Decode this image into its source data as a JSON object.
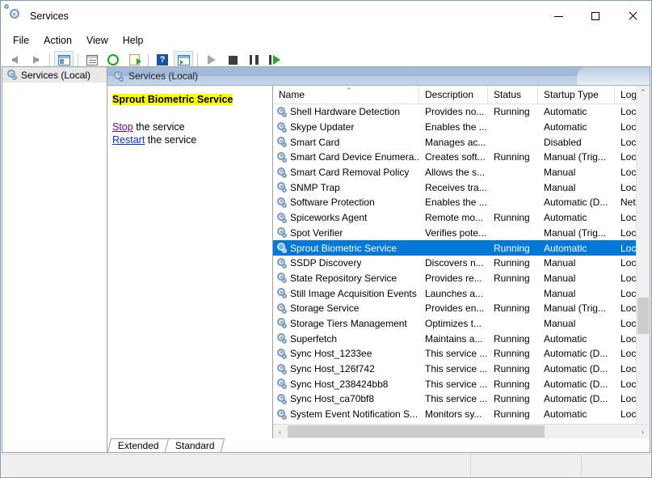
{
  "window": {
    "title": "Services",
    "icon": "services-gear-icon",
    "minimize": "minimize",
    "maximize": "maximize",
    "close": "close"
  },
  "menubar": {
    "items": [
      {
        "label": "File",
        "name": "menu-file"
      },
      {
        "label": "Action",
        "name": "menu-action"
      },
      {
        "label": "View",
        "name": "menu-view"
      },
      {
        "label": "Help",
        "name": "menu-help"
      }
    ]
  },
  "toolbar": {
    "buttons": [
      {
        "name": "back-button",
        "icon": "arrow-left-icon"
      },
      {
        "name": "forward-button",
        "icon": "arrow-right-icon"
      },
      {
        "name": "show-hide-console-tree-button",
        "icon": "console-tree-icon"
      },
      {
        "name": "properties-button",
        "icon": "properties-icon"
      },
      {
        "name": "refresh-button",
        "icon": "refresh-icon"
      },
      {
        "name": "export-list-button",
        "icon": "export-list-icon"
      },
      {
        "name": "help-button",
        "icon": "help-icon"
      },
      {
        "name": "show-action-pane-button",
        "icon": "action-pane-icon"
      },
      {
        "name": "start-service-button",
        "icon": "play-icon"
      },
      {
        "name": "stop-service-button",
        "icon": "stop-icon"
      },
      {
        "name": "pause-service-button",
        "icon": "pause-icon"
      },
      {
        "name": "restart-service-button",
        "icon": "restart-icon"
      }
    ]
  },
  "tree": {
    "root_label": "Services (Local)",
    "root_icon": "services-gear-icon"
  },
  "pane": {
    "header_label": "Services (Local)",
    "header_icon": "services-gear-icon"
  },
  "detail": {
    "service_name": "Sprout Biometric Service",
    "highlight_color": "#ffff00",
    "stop_link": "Stop",
    "stop_suffix": " the service",
    "restart_link": "Restart",
    "restart_suffix": " the service"
  },
  "list": {
    "sort_column": "Name",
    "sort_indicator": "⌃",
    "columns": [
      {
        "label": "Name",
        "name": "column-header-name"
      },
      {
        "label": "Description",
        "name": "column-header-description"
      },
      {
        "label": "Status",
        "name": "column-header-status"
      },
      {
        "label": "Startup Type",
        "name": "column-header-startup-type"
      },
      {
        "label": "Log",
        "name": "column-header-log-on-as"
      }
    ],
    "selected_index": 9,
    "rows": [
      {
        "name": "Shell Hardware Detection",
        "description": "Provides no...",
        "status": "Running",
        "startup": "Automatic",
        "logon": "Loc"
      },
      {
        "name": "Skype Updater",
        "description": "Enables the ...",
        "status": "",
        "startup": "Automatic",
        "logon": "Loc"
      },
      {
        "name": "Smart Card",
        "description": "Manages ac...",
        "status": "",
        "startup": "Disabled",
        "logon": "Loc"
      },
      {
        "name": "Smart Card Device Enumera...",
        "description": "Creates soft...",
        "status": "Running",
        "startup": "Manual (Trig...",
        "logon": "Loc"
      },
      {
        "name": "Smart Card Removal Policy",
        "description": "Allows the s...",
        "status": "",
        "startup": "Manual",
        "logon": "Loc"
      },
      {
        "name": "SNMP Trap",
        "description": "Receives tra...",
        "status": "",
        "startup": "Manual",
        "logon": "Loc"
      },
      {
        "name": "Software Protection",
        "description": "Enables the ...",
        "status": "",
        "startup": "Automatic (D...",
        "logon": "Net"
      },
      {
        "name": "Spiceworks Agent",
        "description": "Remote mo...",
        "status": "Running",
        "startup": "Automatic",
        "logon": "Loc"
      },
      {
        "name": "Spot Verifier",
        "description": "Verifies pote...",
        "status": "",
        "startup": "Manual (Trig...",
        "logon": "Loc"
      },
      {
        "name": "Sprout Biometric Service",
        "description": "",
        "status": "Running",
        "startup": "Automatic",
        "logon": "Loc"
      },
      {
        "name": "SSDP Discovery",
        "description": "Discovers n...",
        "status": "Running",
        "startup": "Manual",
        "logon": "Loc"
      },
      {
        "name": "State Repository Service",
        "description": "Provides re...",
        "status": "Running",
        "startup": "Manual",
        "logon": "Loc"
      },
      {
        "name": "Still Image Acquisition Events",
        "description": "Launches a...",
        "status": "",
        "startup": "Manual",
        "logon": "Loc"
      },
      {
        "name": "Storage Service",
        "description": "Provides en...",
        "status": "Running",
        "startup": "Manual (Trig...",
        "logon": "Loc"
      },
      {
        "name": "Storage Tiers Management",
        "description": "Optimizes t...",
        "status": "",
        "startup": "Manual",
        "logon": "Loc"
      },
      {
        "name": "Superfetch",
        "description": "Maintains a...",
        "status": "Running",
        "startup": "Automatic",
        "logon": "Loc"
      },
      {
        "name": "Sync Host_1233ee",
        "description": "This service ...",
        "status": "Running",
        "startup": "Automatic (D...",
        "logon": "Loc"
      },
      {
        "name": "Sync Host_126f742",
        "description": "This service ...",
        "status": "Running",
        "startup": "Automatic (D...",
        "logon": "Loc"
      },
      {
        "name": "Sync Host_238424bb8",
        "description": "This service ...",
        "status": "Running",
        "startup": "Automatic (D...",
        "logon": "Loc"
      },
      {
        "name": "Sync Host_ca70bf8",
        "description": "This service ...",
        "status": "Running",
        "startup": "Automatic (D...",
        "logon": "Loc"
      },
      {
        "name": "System Event Notification S...",
        "description": "Monitors sy...",
        "status": "Running",
        "startup": "Automatic",
        "logon": "Loc"
      }
    ],
    "scroll_up": "⌃",
    "scroll_down": "⌄",
    "scroll_left": "‹",
    "scroll_right": "›"
  },
  "tabs": [
    {
      "label": "Extended",
      "name": "tab-extended",
      "active": false
    },
    {
      "label": "Standard",
      "name": "tab-standard",
      "active": true
    }
  ],
  "statusbar": {
    "pane1": "",
    "pane2": "",
    "pane3": ""
  },
  "colors": {
    "selection": "#0078d7",
    "highlight": "#ffff00",
    "link_visited": "#800080",
    "link_new": "#0033cc"
  }
}
